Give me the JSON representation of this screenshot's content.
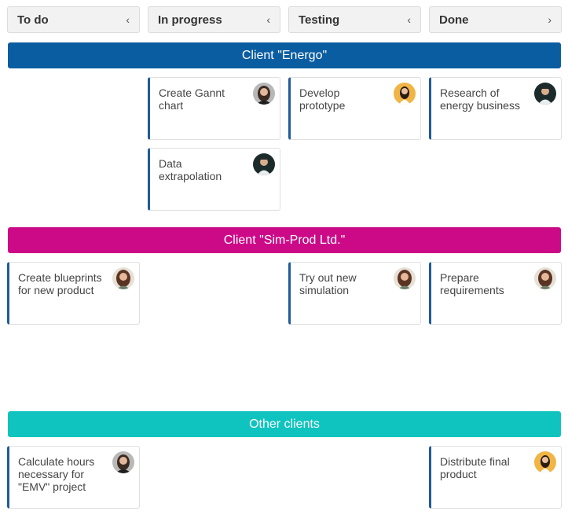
{
  "columns": [
    {
      "label": "To do",
      "chevron": "‹"
    },
    {
      "label": "In progress",
      "chevron": "‹"
    },
    {
      "label": "Testing",
      "chevron": "‹"
    },
    {
      "label": "Done",
      "chevron": "›"
    }
  ],
  "swimlanes": [
    {
      "title": "Client \"Energo\"",
      "color": "#0b5da1"
    },
    {
      "title": "Client \"Sim-Prod Ltd.\"",
      "color": "#cc0a87"
    },
    {
      "title": "Other clients",
      "color": "#0fc4bf"
    }
  ],
  "cards": {
    "gantt": {
      "text": "Create Gannt chart",
      "avatar": "avatar-woman-dark-hair"
    },
    "prototype": {
      "text": "Develop prototype",
      "avatar": "avatar-woman-yellow-bg"
    },
    "research": {
      "text": "Research of energy business",
      "avatar": "avatar-man-dark-bg"
    },
    "extrapolation": {
      "text": "Data extrapolation",
      "avatar": "avatar-man-dark-bg"
    },
    "blueprints": {
      "text": "Create blueprints for new product",
      "avatar": "avatar-woman-brown-hair"
    },
    "simulation": {
      "text": "Try out new simulation",
      "avatar": "avatar-woman-brown-hair"
    },
    "requirements": {
      "text": "Prepare requirements",
      "avatar": "avatar-woman-brown-hair"
    },
    "hours": {
      "text": "Calculate hours necessary for \"EMV\" project",
      "avatar": "avatar-woman-dark-hair"
    },
    "distribute": {
      "text": "Distribute final product",
      "avatar": "avatar-woman-yellow-bg"
    }
  },
  "colors": {
    "card_accent": "#1f5c99"
  }
}
